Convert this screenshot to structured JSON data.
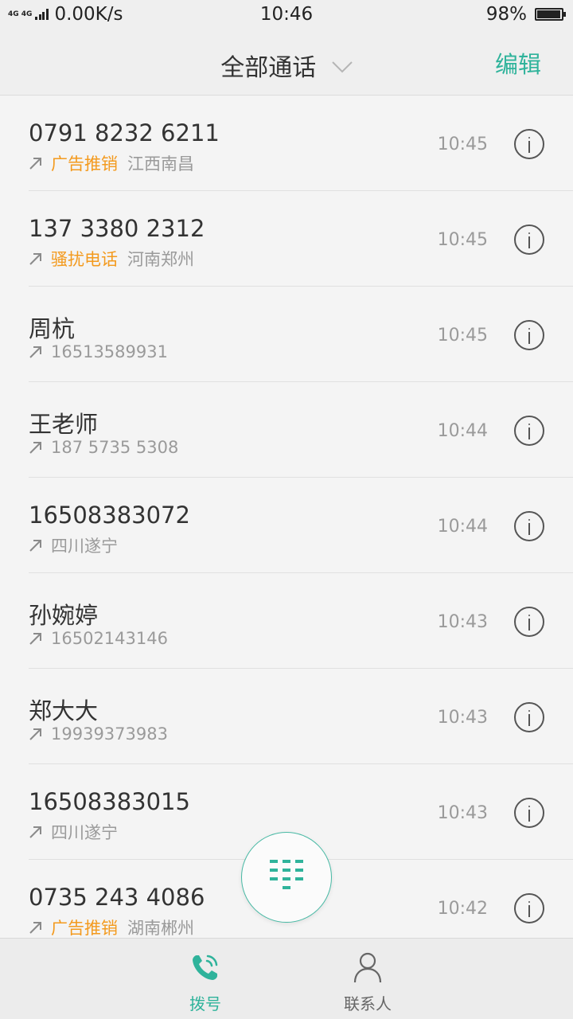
{
  "status_bar": {
    "network": "4G 4G",
    "speed": "0.00K/s",
    "time": "10:46",
    "battery": "98%",
    "battery_level": 0.98
  },
  "header": {
    "title": "全部通话",
    "edit": "编辑"
  },
  "calls": [
    {
      "name": "0791 8232 6211",
      "tag": "广告推销",
      "detail": "江西南昌",
      "time": "10:45"
    },
    {
      "name": "137 3380 2312",
      "tag": "骚扰电话",
      "detail": "河南郑州",
      "time": "10:45"
    },
    {
      "name": "周杭",
      "tag": "",
      "detail": "16513589931",
      "time": "10:45"
    },
    {
      "name": "王老师",
      "tag": "",
      "detail": "187 5735 5308",
      "time": "10:44"
    },
    {
      "name": "16508383072",
      "tag": "",
      "detail": "四川遂宁",
      "time": "10:44"
    },
    {
      "name": "孙婉婷",
      "tag": "",
      "detail": "16502143146",
      "time": "10:43"
    },
    {
      "name": "郑大大",
      "tag": "",
      "detail": "19939373983",
      "time": "10:43"
    },
    {
      "name": "16508383015",
      "tag": "",
      "detail": "四川遂宁",
      "time": "10:43"
    },
    {
      "name": "0735 243 4086",
      "tag": "广告推销",
      "detail": "湖南郴州",
      "time": "10:42"
    }
  ],
  "bottom_nav": {
    "dial": "拨号",
    "contacts": "联系人"
  },
  "colors": {
    "accent": "#2fb39b",
    "tag": "#f39a1e",
    "background": "#f4f4f4"
  },
  "icons": {
    "call_direction": "outgoing-arrow-icon",
    "info": "info-icon",
    "fab": "dialpad-icon",
    "dial_tab": "phone-icon",
    "contacts_tab": "person-icon"
  }
}
